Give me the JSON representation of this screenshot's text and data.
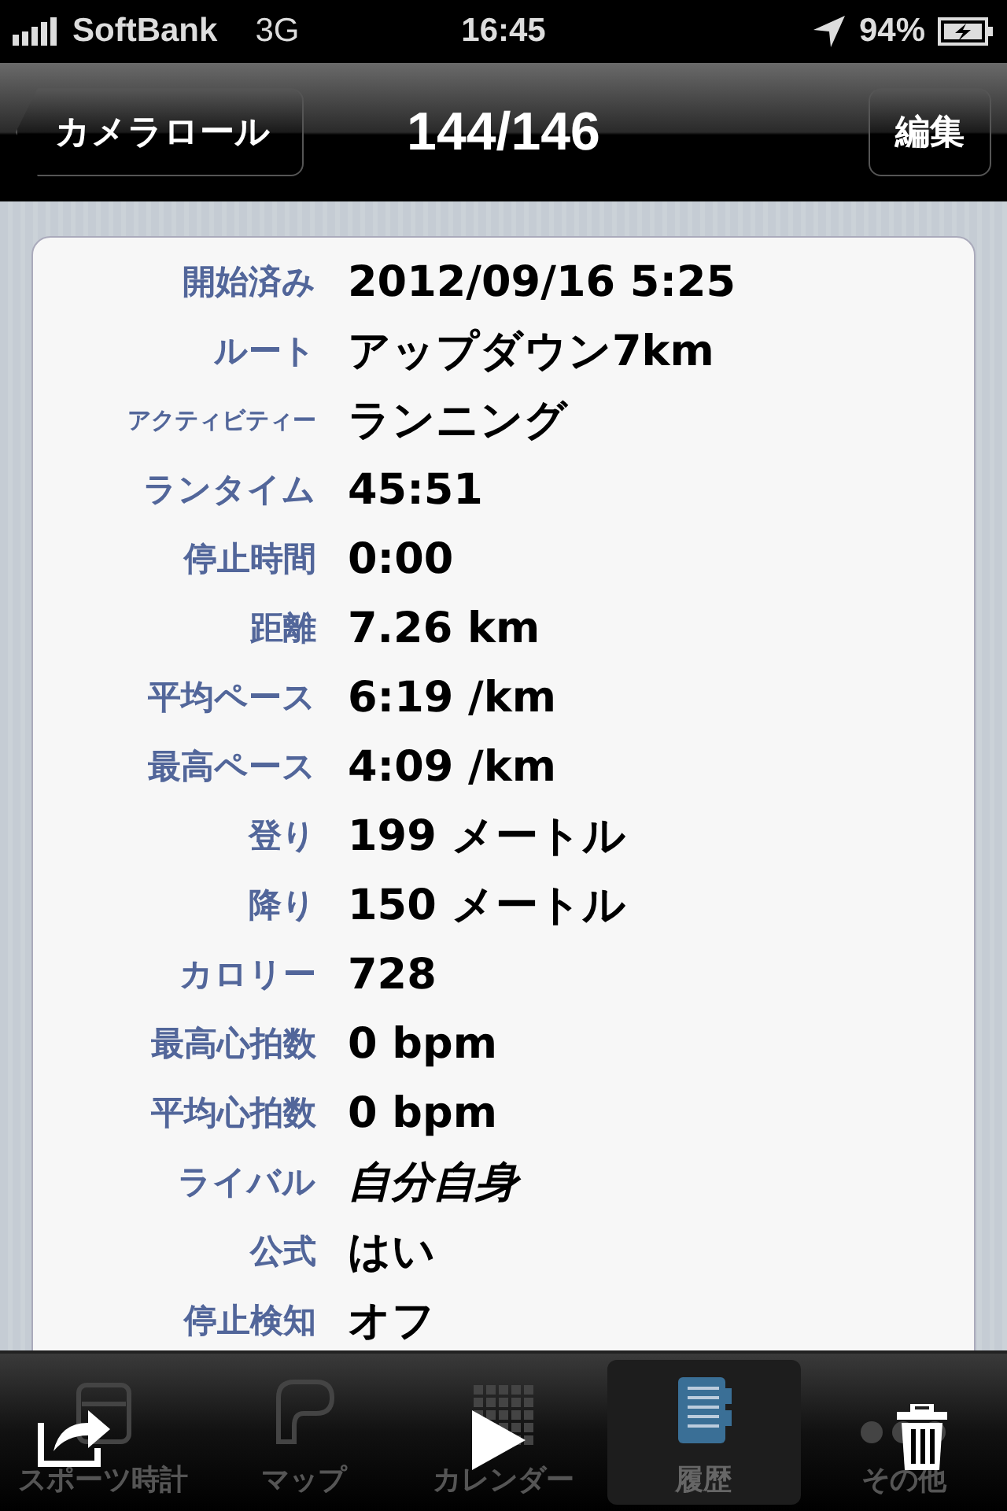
{
  "status_bar": {
    "carrier": "SoftBank",
    "network": "3G",
    "time": "16:45",
    "battery": "94%"
  },
  "nav": {
    "back": "カメラロール",
    "title": "144/146",
    "edit": "編集"
  },
  "details": [
    {
      "label": "開始済み",
      "value": "2012/09/16 5:25",
      "italic": false
    },
    {
      "label": "ルート",
      "value": "アップダウン7km",
      "italic": false
    },
    {
      "label": "アクティビティー",
      "value": "ランニング",
      "italic": false
    },
    {
      "label": "ランタイム",
      "value": "45:51",
      "italic": false
    },
    {
      "label": "停止時間",
      "value": "0:00",
      "italic": false
    },
    {
      "label": "距離",
      "value": "7.26 km",
      "italic": false
    },
    {
      "label": "平均ペース",
      "value": "6:19 /km",
      "italic": false
    },
    {
      "label": "最高ペース",
      "value": "4:09 /km",
      "italic": false
    },
    {
      "label": "登り",
      "value": "199 メートル",
      "italic": false
    },
    {
      "label": "降り",
      "value": "150 メートル",
      "italic": false
    },
    {
      "label": "カロリー",
      "value": "728",
      "italic": false
    },
    {
      "label": "最高心拍数",
      "value": "0 bpm",
      "italic": false
    },
    {
      "label": "平均心拍数",
      "value": "0 bpm",
      "italic": false
    },
    {
      "label": "ライバル",
      "value": "自分自身",
      "italic": true
    },
    {
      "label": "公式",
      "value": "はい",
      "italic": false
    },
    {
      "label": "停止検知",
      "value": "オフ",
      "italic": false
    }
  ],
  "tabs": [
    {
      "label": "スポーツ時計",
      "kind": "watch",
      "selected": false
    },
    {
      "label": "マップ",
      "kind": "map",
      "selected": false
    },
    {
      "label": "カレンダー",
      "kind": "calendar",
      "selected": false
    },
    {
      "label": "履歴",
      "kind": "history",
      "selected": true
    },
    {
      "label": "その他",
      "kind": "more",
      "selected": false
    }
  ]
}
